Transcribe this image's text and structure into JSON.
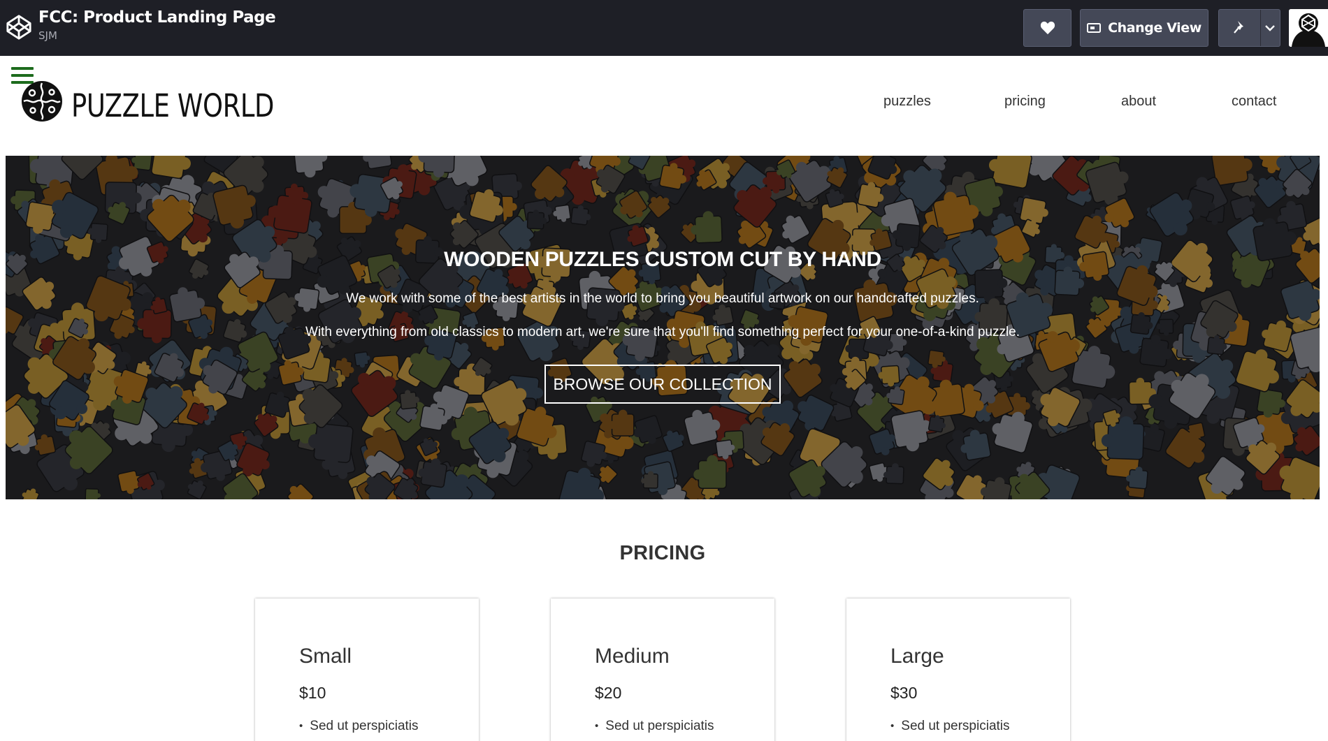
{
  "codepen": {
    "title": "FCC: Product Landing Page",
    "author": "SJM",
    "change_view_label": "Change View"
  },
  "site": {
    "brand": "PUZZLE WORLD",
    "nav": [
      "puzzles",
      "pricing",
      "about",
      "contact"
    ]
  },
  "hero": {
    "title": "WOODEN PUZZLES CUSTOM CUT BY HAND",
    "paragraph1": "We work with some of the best artists in the world to bring you beautiful artwork on our handcrafted puzzles.",
    "paragraph2": "With everything from old classics to modern art, we're sure that you'll find something perfect for your one-of-a-kind puzzle.",
    "button": "BROWSE OUR COLLECTION"
  },
  "pricing": {
    "title": "PRICING",
    "cards": [
      {
        "name": "Small",
        "price": "$10",
        "item": "Sed ut perspiciatis"
      },
      {
        "name": "Medium",
        "price": "$20",
        "item": "Sed ut perspiciatis"
      },
      {
        "name": "Large",
        "price": "$30",
        "item": "Sed ut perspiciatis"
      }
    ]
  },
  "colors": {
    "codepen_bar": "#1e1f26",
    "codepen_button": "#444857",
    "menu_icon": "#1d6b1d"
  },
  "icons": [
    "codepen-logo-icon",
    "heart-icon",
    "change-view-icon",
    "pin-icon",
    "chevron-down-icon",
    "avatar",
    "hamburger-menu-icon",
    "puzzle-logo-icon"
  ]
}
